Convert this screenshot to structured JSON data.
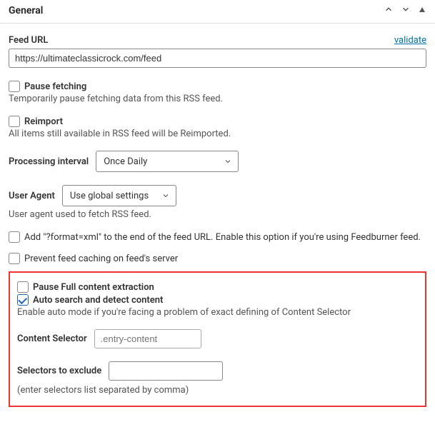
{
  "panel": {
    "title": "General"
  },
  "feed_url": {
    "label": "Feed URL",
    "validate": "validate",
    "value": "https://ultimateclassicrock.com/feed"
  },
  "pause_fetching": {
    "label": "Pause fetching",
    "helper": "Temporarily pause fetching data from this RSS feed."
  },
  "reimport": {
    "label": "Reimport",
    "helper": "All items still available in RSS feed will be Reimported."
  },
  "processing_interval": {
    "label": "Processing interval",
    "value": "Once Daily"
  },
  "user_agent": {
    "label": "User Agent",
    "value": "Use global settings",
    "helper": "User agent used to fetch RSS feed."
  },
  "format_xml": {
    "label": "Add \"?format=xml\" to the end of the feed URL. Enable this option if you're using Feedburner feed."
  },
  "prevent_caching": {
    "label": "Prevent feed caching on feed's server"
  },
  "pause_full_content": {
    "label": "Pause Full content extraction"
  },
  "auto_search": {
    "label": "Auto search and detect content",
    "helper": "Enable auto mode if you're facing a problem of exact defining of Content Selector"
  },
  "content_selector": {
    "label": "Content Selector",
    "placeholder": ".entry-content"
  },
  "selectors_exclude": {
    "label": "Selectors to exclude",
    "value": "",
    "helper": "(enter selectors list separated by comma)"
  }
}
